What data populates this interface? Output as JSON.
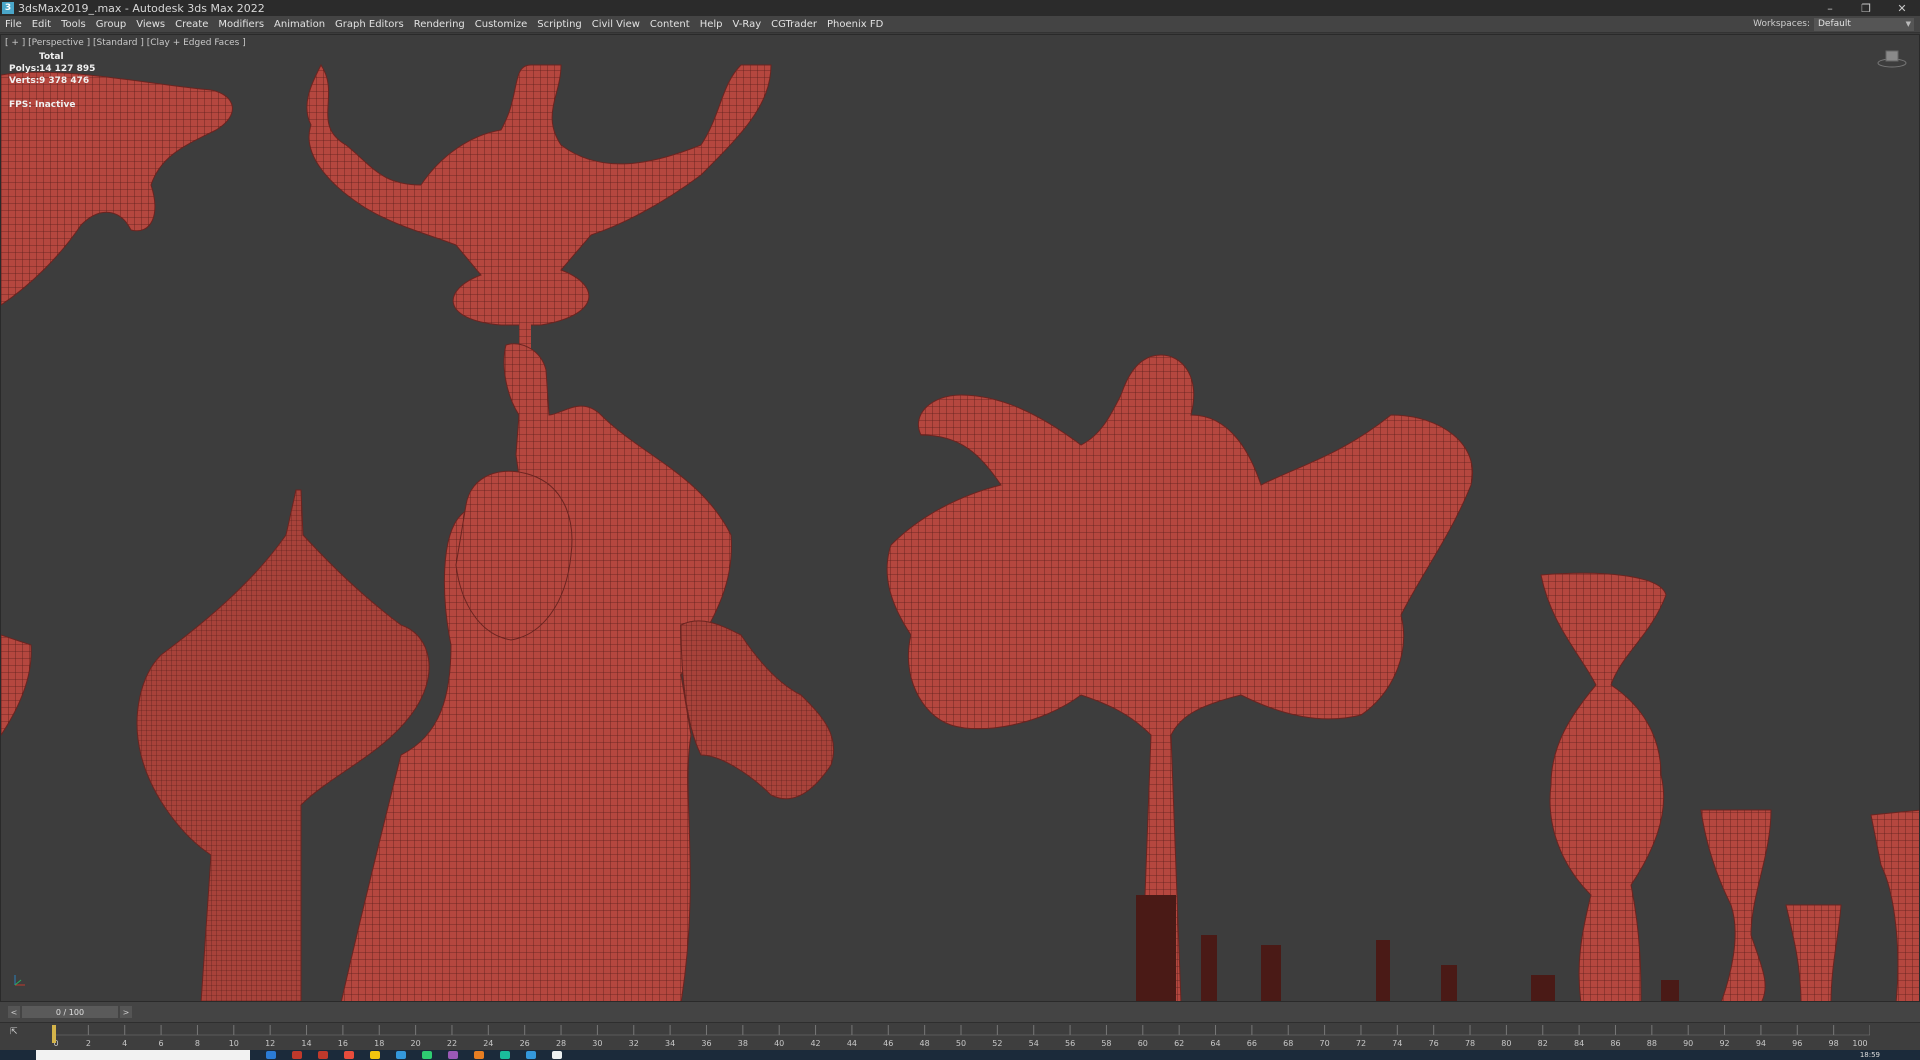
{
  "titlebar": {
    "app_icon": "3",
    "title": "3dsMax2019_.max - Autodesk 3ds Max 2022",
    "minimize": "–",
    "restore": "❐",
    "close": "✕"
  },
  "menu": {
    "items": [
      "File",
      "Edit",
      "Tools",
      "Group",
      "Views",
      "Create",
      "Modifiers",
      "Animation",
      "Graph Editors",
      "Rendering",
      "Customize",
      "Scripting",
      "Civil View",
      "Content",
      "Help",
      "V-Ray",
      "CGTrader",
      "Phoenix FD"
    ],
    "workspaces_label": "Workspaces:",
    "workspace_value": "Default"
  },
  "viewport": {
    "label": "[ + ] [Perspective ] [Standard ] [Clay + Edged Faces ]",
    "stats": {
      "total_label": "Total",
      "polys_label": "Polys:",
      "polys_value": "14 127 895",
      "verts_label": "Verts:",
      "verts_value": "9 378 476"
    },
    "fps_label": "FPS:",
    "fps_value": "Inactive",
    "mesh_color": "#b5473f",
    "background_color": "#3d3d3d"
  },
  "timeline": {
    "slider_value": "0 / 100",
    "prev": "<",
    "next": ">",
    "key_mode": "⇱",
    "ticks": [
      "0",
      "2",
      "4",
      "6",
      "8",
      "10",
      "12",
      "14",
      "16",
      "18",
      "20",
      "22",
      "24",
      "26",
      "28",
      "30",
      "32",
      "34",
      "36",
      "38",
      "40",
      "42",
      "44",
      "46",
      "48",
      "50",
      "52",
      "54",
      "56",
      "58",
      "60",
      "62",
      "64",
      "66",
      "68",
      "70",
      "72",
      "74",
      "76",
      "78",
      "80",
      "82",
      "84",
      "86",
      "88",
      "90",
      "92",
      "94",
      "96",
      "98",
      "100"
    ]
  },
  "taskbar": {
    "clock": "18:59",
    "icons": [
      "#2b7bd4",
      "#c0392b",
      "#c0392b",
      "#e74c3c",
      "#f1c40f",
      "#3498db",
      "#2ecc71",
      "#9b59b6",
      "#e67e22",
      "#1abc9c",
      "#3498db",
      "#ecf0f1"
    ]
  }
}
